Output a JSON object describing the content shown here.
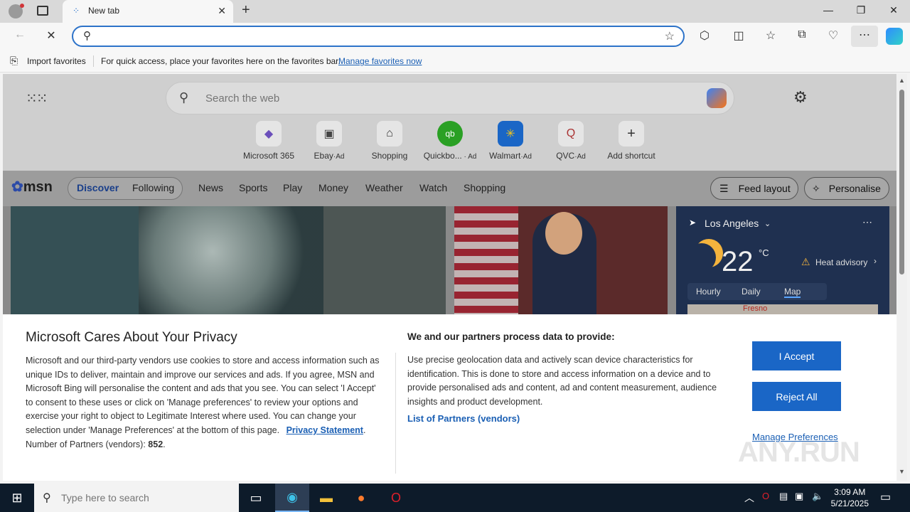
{
  "browser": {
    "tab_title": "New tab",
    "address_value": "",
    "favorites_bar": {
      "import_label": "Import favorites",
      "message": "For quick access, place your favorites here on the favorites bar.",
      "manage_link": "Manage favorites now"
    }
  },
  "newtab": {
    "search_placeholder": "Search the web",
    "shortcuts": [
      {
        "label": "Microsoft 365",
        "ad": ""
      },
      {
        "label": "Ebay",
        "ad": "Ad"
      },
      {
        "label": "Shopping",
        "ad": ""
      },
      {
        "label": "Quickbo...",
        "ad": "Ad"
      },
      {
        "label": "Walmart",
        "ad": "Ad"
      },
      {
        "label": "QVC",
        "ad": "Ad"
      },
      {
        "label": "Add shortcut",
        "ad": ""
      }
    ],
    "msn_logo": "msn",
    "tabs": [
      "Discover",
      "Following"
    ],
    "nav": [
      "News",
      "Sports",
      "Play",
      "Money",
      "Weather",
      "Watch",
      "Shopping"
    ],
    "feed_layout": "Feed layout",
    "personalise": "Personalise",
    "weather": {
      "location": "Los Angeles",
      "temp": "22",
      "unit": "°C",
      "advisory": "Heat advisory",
      "tabs": [
        "Hourly",
        "Daily",
        "Map"
      ],
      "map_label": "Fresno"
    }
  },
  "privacy": {
    "title": "Microsoft Cares About Your Privacy",
    "body": "Microsoft and our third-party vendors use cookies to store and access information such as unique IDs to deliver, maintain and improve our services and ads. If you agree, MSN and Microsoft Bing will personalise the content and ads that you see. You can select 'I Accept' to consent to these uses or click on 'Manage preferences' to review your options and exercise your right to object to Legitimate Interest where used.  You can change your selection under 'Manage Preferences' at the bottom of this page.",
    "privacy_link": "Privacy Statement",
    "partners_label": "Number of Partners (vendors):",
    "partners_count": "852",
    "process_title": "We and our partners process data to provide:",
    "process_body": "Use precise geolocation data and actively scan device characteristics for identification. This is done to store and access information on a device and to provide personalised ads and content, ad and content measurement, audience insights and product development.",
    "partners_link": "List of Partners (vendors)",
    "accept": "I Accept",
    "reject": "Reject All",
    "manage": "Manage Preferences"
  },
  "taskbar": {
    "search_placeholder": "Type here to search",
    "time": "3:09 AM",
    "date": "5/21/2025"
  },
  "watermark": "ANY.RUN"
}
